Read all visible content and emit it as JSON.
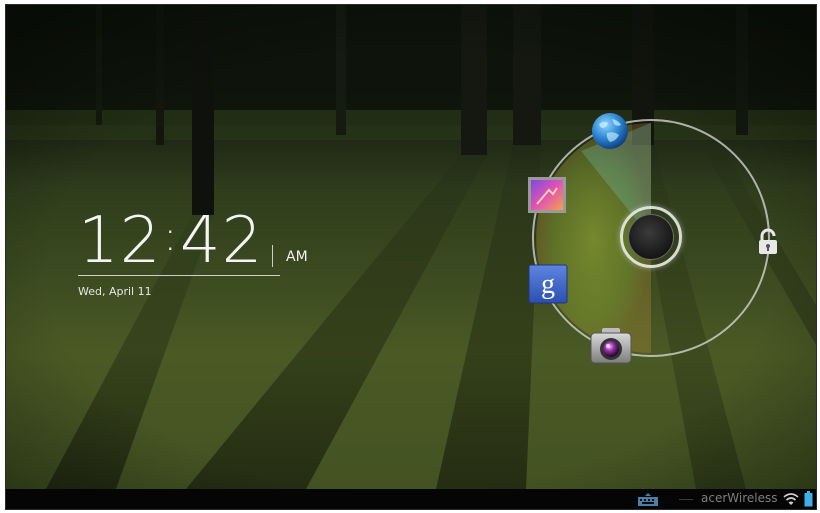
{
  "clock": {
    "hours": "12",
    "minutes": "42",
    "ampm": "AM",
    "date": "Wed, April 11"
  },
  "unlock_targets": {
    "browser": "globe-icon",
    "gallery": "gallery-icon",
    "search": "google-g-icon",
    "camera": "camera-icon",
    "unlock": "lock-icon"
  },
  "status_bar": {
    "network_name": "acerWireless",
    "keyboard_icon": "keyboard-icon",
    "wifi_icon": "wifi-icon",
    "battery_icon": "battery-icon"
  },
  "colors": {
    "ring": "#dcdcdc",
    "glow_green": "#b7d23a",
    "glow_orange": "#e39a3a",
    "google_blue": "#3b62c8",
    "battery": "#3fb0e6"
  }
}
